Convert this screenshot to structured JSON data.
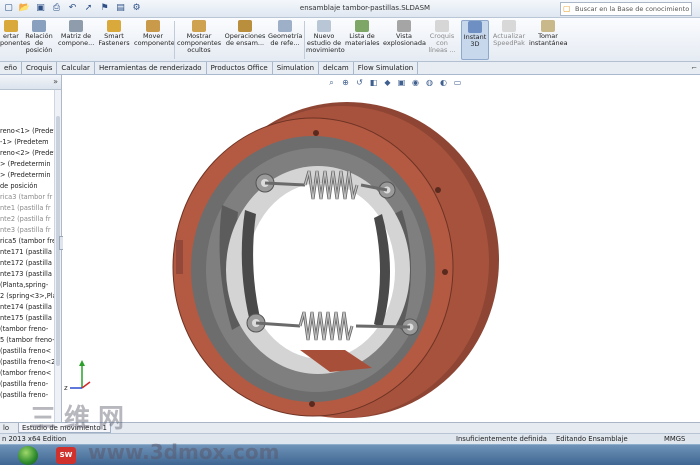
{
  "window": {
    "title": "ensamblaje tambor-pastillas.SLDASM",
    "search_placeholder": "Buscar en la Base de conocimiento"
  },
  "ribbon": {
    "buttons": [
      {
        "label": "ertar\nponentes",
        "icon": "insert-components-icon",
        "enabled": true
      },
      {
        "label": "Relación\nde\nposición",
        "icon": "mate-icon",
        "enabled": true
      },
      {
        "label": "Matriz de\ncompone...",
        "icon": "component-pattern-icon",
        "enabled": true
      },
      {
        "label": "Smart\nFasteners",
        "icon": "smart-fasteners-icon",
        "enabled": true
      },
      {
        "label": "Mover\ncomponente",
        "icon": "move-component-icon",
        "enabled": true
      },
      {
        "label": "Mostrar\ncomponentes\nocultos",
        "icon": "show-hidden-icon",
        "enabled": true
      },
      {
        "label": "Operaciones\nde ensam...",
        "icon": "assembly-features-icon",
        "enabled": true
      },
      {
        "label": "Geometría\nde refe...",
        "icon": "reference-geometry-icon",
        "enabled": true
      },
      {
        "label": "Nuevo\nestudio de\nmovimiento",
        "icon": "motion-study-icon",
        "enabled": true
      },
      {
        "label": "Lista de\nmateriales",
        "icon": "bill-of-materials-icon",
        "enabled": true
      },
      {
        "label": "Vista\nexplosionada",
        "icon": "exploded-view-icon",
        "enabled": true
      },
      {
        "label": "Croquis\ncon\nlíneas ...",
        "icon": "explode-line-sketch-icon",
        "enabled": false
      },
      {
        "label": "Instant\n3D",
        "icon": "instant-3d-icon",
        "enabled": true,
        "active": true
      },
      {
        "label": "Actualizar\nSpeedPak",
        "icon": "speedpak-icon",
        "enabled": false
      },
      {
        "label": "Tomar\ninstantánea",
        "icon": "snapshot-icon",
        "enabled": true
      }
    ]
  },
  "tabs": [
    "eño",
    "Croquis",
    "Calcular",
    "Herramientas de renderizado",
    "Productos Office",
    "Simulation",
    "delcam",
    "Flow Simulation"
  ],
  "tree": {
    "items": [
      {
        "label": "reno<1> (Predete",
        "grey": false
      },
      {
        "label": "-1> (Predetem",
        "grey": false
      },
      {
        "label": "reno<2> (Predete",
        "grey": false
      },
      {
        "label": "> (Predetermin",
        "grey": false
      },
      {
        "label": "> (Predetermin",
        "grey": false
      },
      {
        "label": "de posición",
        "grey": false
      },
      {
        "label": "rica3 (tambor fr",
        "grey": true
      },
      {
        "label": "nte1 (pastilla fr",
        "grey": true
      },
      {
        "label": "nte2 (pastilla fr",
        "grey": true
      },
      {
        "label": "nte3 (pastilla fr",
        "grey": true
      },
      {
        "label": "rica5 (tambor fre",
        "grey": false
      },
      {
        "label": "nte171 (pastilla",
        "grey": false
      },
      {
        "label": "nte172 (pastilla",
        "grey": false
      },
      {
        "label": "nte173 (pastilla",
        "grey": false
      },
      {
        "label": "(Planta,spring-",
        "grey": false
      },
      {
        "label": "2 (spring<3>,Pla",
        "grey": false
      },
      {
        "label": "nte174 (pastilla",
        "grey": false
      },
      {
        "label": "nte175 (pastilla",
        "grey": false
      },
      {
        "label": "(tambor freno-",
        "grey": false
      },
      {
        "label": "5 (tambor freno-",
        "grey": false
      },
      {
        "label": "(pastilla freno<",
        "grey": false
      },
      {
        "label": "(pastilla freno<2",
        "grey": false
      },
      {
        "label": "(tambor freno<",
        "grey": false
      },
      {
        "label": "(pastilla freno-",
        "grey": false
      },
      {
        "label": "(pastilla freno-",
        "grey": false
      }
    ]
  },
  "bottom_tabs": [
    "lo",
    "Estudio de movimiento 1"
  ],
  "status": {
    "app": "n 2013 x64 Edition",
    "left_msg": "Insuficientemente definida",
    "editing": "Editando Ensamblaje",
    "units": "MMGS"
  },
  "taskbar": {
    "app_label": "SW"
  },
  "watermark": {
    "text": "三维网",
    "url": "www.3dmox.com"
  },
  "colors": {
    "drum_outer": "#a0503c",
    "drum_face": "#b2573f",
    "drum_inner": "#7b7b7b",
    "spring": "#b4b4b4",
    "ribbon_bg": "#eef2f7",
    "accent": "#4a6ea9"
  }
}
